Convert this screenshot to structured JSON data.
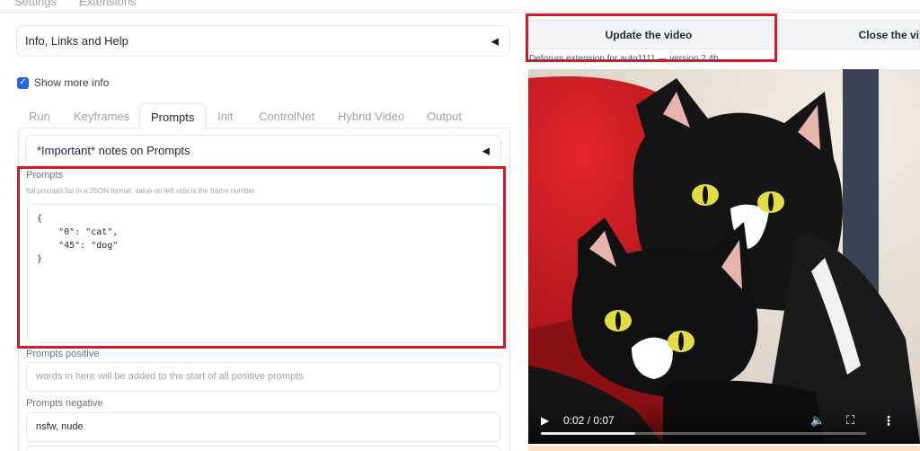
{
  "top_tabs": [
    "Settings",
    "Extensions"
  ],
  "info_accordion": {
    "label": "Info, Links and Help"
  },
  "show_more_info": {
    "label": "Show more info",
    "checked": true
  },
  "sub_tabs": [
    {
      "label": "Run",
      "active": false
    },
    {
      "label": "Keyframes",
      "active": false
    },
    {
      "label": "Prompts",
      "active": true
    },
    {
      "label": "Init",
      "active": false
    },
    {
      "label": "ControlNet",
      "active": false
    },
    {
      "label": "Hybrid Video",
      "active": false
    },
    {
      "label": "Output",
      "active": false
    }
  ],
  "notes_accordion": {
    "label": "*Important* notes on Prompts"
  },
  "prompts": {
    "label": "Prompts",
    "info": "full prompts list in a JSON format. value on left side is the frame number",
    "value": "{\n    \"0\": \"cat\",\n    \"45\": \"dog\"\n}"
  },
  "prompts_positive": {
    "label": "Prompts positive",
    "placeholder": "words in here will be added to the start of all positive prompts"
  },
  "prompts_negative": {
    "label": "Prompts negative",
    "value": "nsfw, nude"
  },
  "buttons": {
    "update_video": "Update the video",
    "close_video": "Close the vi"
  },
  "video_info": "Deforum extension for auto1111 — version 2.4b",
  "video": {
    "time": "0:02 / 0:07",
    "progress": 0.29
  },
  "colors": {
    "accent_checkbox": "#2563eb",
    "highlight_red": "#d01b2a"
  }
}
